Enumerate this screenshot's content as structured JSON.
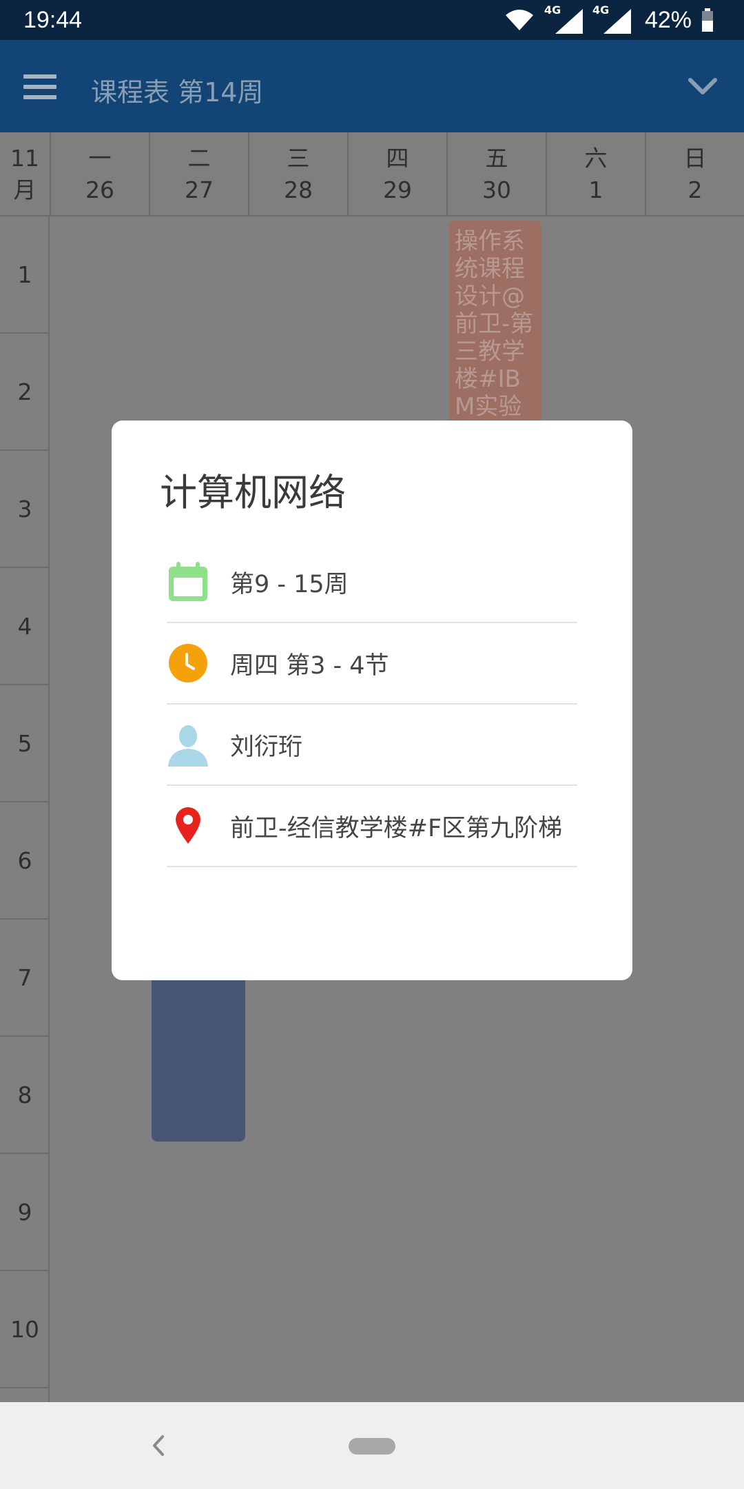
{
  "status_bar": {
    "time": "19:44",
    "network_1": "4G",
    "network_2": "4G",
    "battery": "42%",
    "icons": [
      "wifi-icon",
      "signal-icon",
      "signal-icon",
      "battery-icon"
    ]
  },
  "app_bar": {
    "title": "课程表 第14周",
    "menu_icon": "hamburger-menu-icon",
    "dropdown_icon": "chevron-down-icon"
  },
  "week_header": {
    "month": [
      "11",
      "月"
    ],
    "days": [
      {
        "weekday": "一",
        "date": "26"
      },
      {
        "weekday": "二",
        "date": "27"
      },
      {
        "weekday": "三",
        "date": "28"
      },
      {
        "weekday": "四",
        "date": "29"
      },
      {
        "weekday": "五",
        "date": "30"
      },
      {
        "weekday": "六",
        "date": "1"
      },
      {
        "weekday": "日",
        "date": "2"
      }
    ]
  },
  "periods": [
    "1",
    "2",
    "3",
    "4",
    "5",
    "6",
    "7",
    "8",
    "9",
    "10"
  ],
  "courses": [
    {
      "text": "操作系统课程设计@前卫-第三教学楼#IBM实验室",
      "color": "#9c6f62"
    },
    {
      "text": "",
      "color": "#485674"
    }
  ],
  "dialog": {
    "title": "计算机网络",
    "weeks": "第9 - 15周",
    "time": "周四 第3 - 4节",
    "teacher": "刘衍珩",
    "location": "前卫-经信教学楼#F区第九阶梯",
    "icon_colors": {
      "calendar": "#8fe08a",
      "clock": "#f5a10c",
      "person": "#a9d7e8",
      "pin": "#e8231e"
    }
  }
}
